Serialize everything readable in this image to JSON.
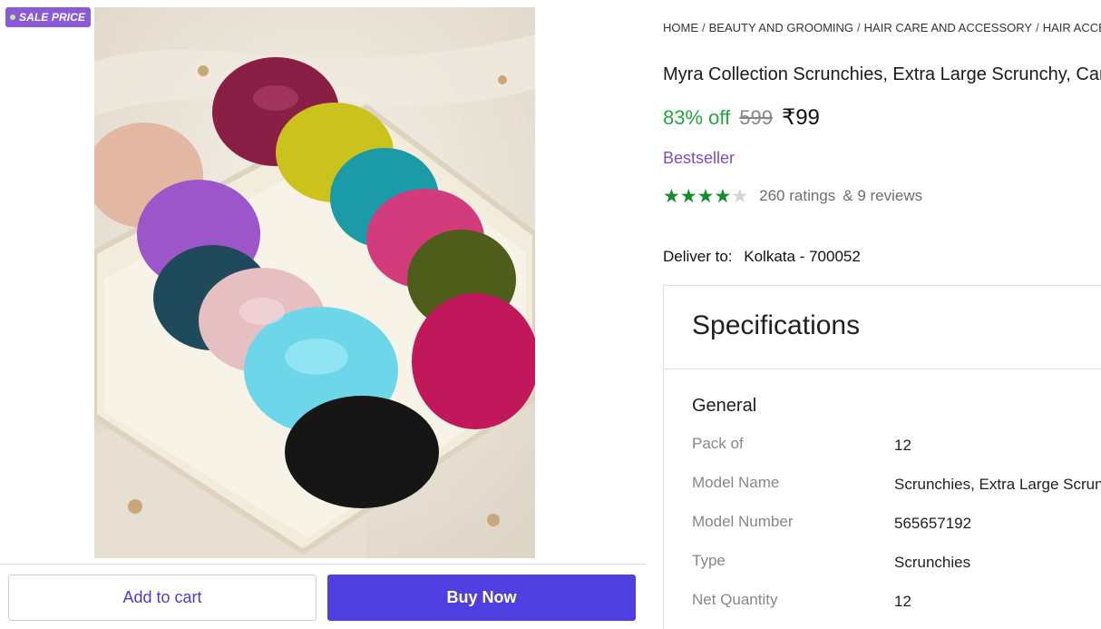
{
  "badge": {
    "label": "SALE PRICE"
  },
  "actions": {
    "add_to_cart": "Add to cart",
    "buy_now": "Buy Now"
  },
  "breadcrumb": [
    "HOME",
    "BEAUTY AND GROOMING",
    "HAIR CARE AND ACCESSORY",
    "HAIR ACCESSORY"
  ],
  "product": {
    "title": "Myra Collection Scrunchies, Extra Large Scrunchy, Candy Color",
    "discount": "83% off",
    "mrp": "599",
    "price": "₹99",
    "tag": "Bestseller",
    "rating": {
      "stars": 4,
      "out_of": 5,
      "ratings": "260 ratings",
      "reviews": "& 9 reviews"
    }
  },
  "delivery": {
    "label": "Deliver to:",
    "location": "Kolkata - 700052"
  },
  "specifications": {
    "title": "Specifications",
    "group": "General",
    "rows": [
      {
        "key": "Pack of",
        "value": "12"
      },
      {
        "key": "Model Name",
        "value": "Scrunchies, Extra Large Scrunchy"
      },
      {
        "key": "Model Number",
        "value": "565657192"
      },
      {
        "key": "Type",
        "value": "Scrunchies"
      },
      {
        "key": "Net Quantity",
        "value": "12"
      }
    ]
  },
  "colors": {
    "accent": "#4f3fe0",
    "discount": "#26a541",
    "bestseller": "#7a4fc4",
    "star": "#168a2e",
    "badge": "#8a5bd6"
  }
}
